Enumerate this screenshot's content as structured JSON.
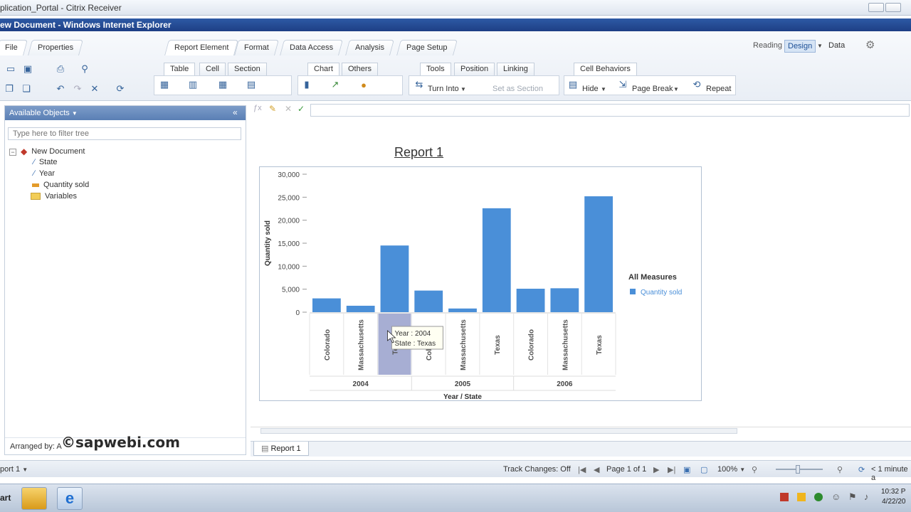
{
  "citrix": {
    "title": "plication_Portal - Citrix Receiver"
  },
  "ie": {
    "title": "ew Document - Windows Internet Explorer"
  },
  "ribbon": {
    "left_tabs": [
      "File",
      "Properties"
    ],
    "main_tabs": [
      "Report Element",
      "Format",
      "Data Access",
      "Analysis",
      "Page Setup"
    ],
    "right_modes": [
      "Reading",
      "Design",
      "Data"
    ],
    "sub_tabs": [
      "Table",
      "Cell",
      "Section",
      "Chart",
      "Others",
      "Tools",
      "Position",
      "Linking",
      "Cell Behaviors"
    ],
    "tools": {
      "turn_into": "Turn Into",
      "set_as_section": "Set as Section",
      "hide": "Hide",
      "page_break": "Page Break",
      "repeat": "Repeat"
    }
  },
  "left_panel": {
    "title": "Available Objects",
    "filter_placeholder": "Type here to filter tree",
    "tree": [
      {
        "label": "New Document",
        "icon": "document-icon"
      },
      {
        "label": "State",
        "icon": "dimension-icon"
      },
      {
        "label": "Year",
        "icon": "dimension-icon"
      },
      {
        "label": "Quantity sold",
        "icon": "measure-icon"
      },
      {
        "label": "Variables",
        "icon": "folder-icon"
      }
    ],
    "arranged_by": "Arranged by:  A"
  },
  "watermark": "©sapwebi.com",
  "report": {
    "title": "Report 1"
  },
  "chart_data": {
    "type": "bar",
    "title": "",
    "ylabel": "Quantity sold",
    "xlabel": "Year / State",
    "ylim": [
      0,
      30000
    ],
    "yticks": [
      "30,000",
      "25,000",
      "20,000",
      "15,000",
      "10,000",
      "5,000",
      "0"
    ],
    "groups": [
      {
        "label": "2004",
        "categories": [
          "Colorado",
          "Massachusetts",
          "Texas"
        ]
      },
      {
        "label": "2005",
        "categories": [
          "Colorado",
          "Massachusetts",
          "Texas"
        ]
      },
      {
        "label": "2006",
        "categories": [
          "Colorado",
          "Massachusetts",
          "Texas"
        ]
      }
    ],
    "series": [
      {
        "name": "Quantity sold",
        "values": [
          3000,
          1400,
          14500,
          4700,
          800,
          22600,
          5100,
          5200,
          25200
        ]
      }
    ],
    "legend": {
      "title": "All Measures",
      "placement": "right"
    },
    "tooltip": {
      "year_label": "Year",
      "year_value": "2004",
      "state_label": "State",
      "state_value": "Texas"
    },
    "highlight_index": 2,
    "bar_color": "#4a8fd8"
  },
  "sheet_tabs": [
    "Report 1"
  ],
  "status": {
    "report_menu": "port 1",
    "track_changes": "Track Changes: Off",
    "page": "Page 1 of 1",
    "zoom": "100%",
    "refresh": "< 1 minute a"
  },
  "taskbar": {
    "start": "art",
    "time": "10:32 P",
    "date": "4/22/20"
  }
}
